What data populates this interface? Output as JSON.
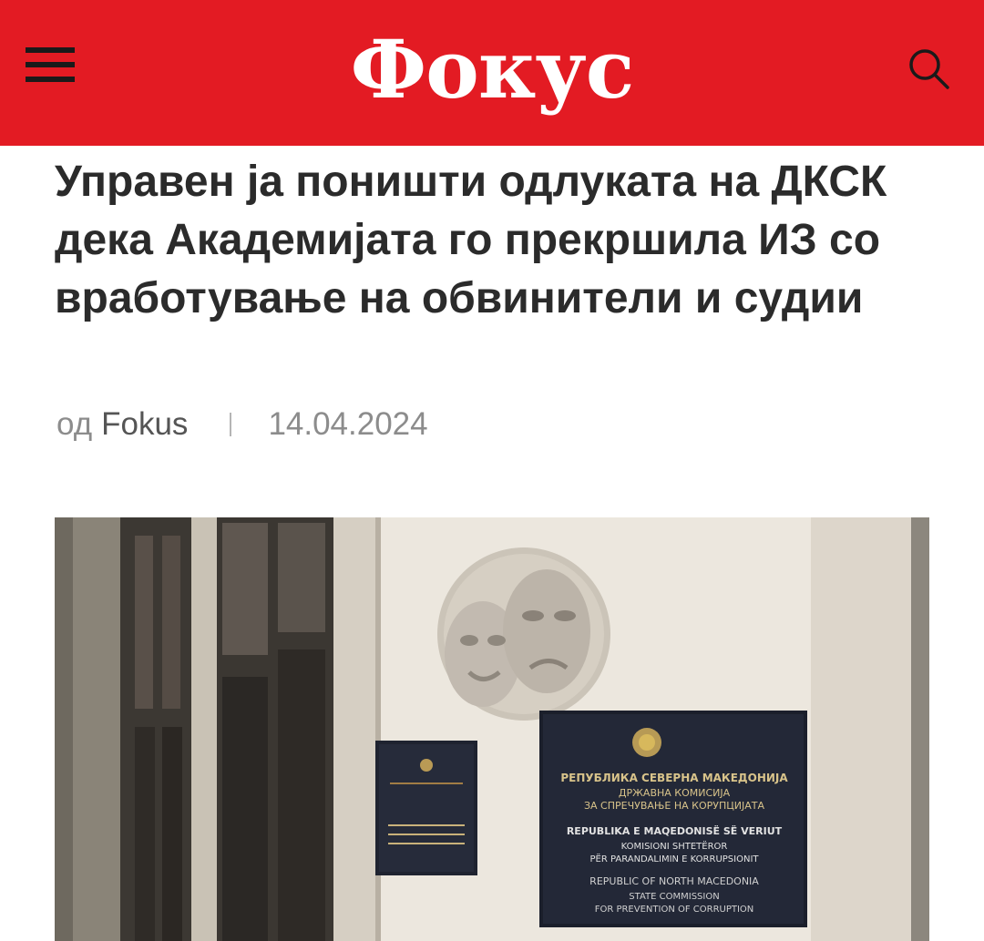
{
  "header": {
    "menu_icon": "hamburger-menu-icon",
    "logo_text": "Фокус",
    "search_icon": "search-icon",
    "brand_color": "#e31b23"
  },
  "article": {
    "title": "Управен ја поништи одлуката на ДКСК дека Академијата го прекршила ИЗ со вработување на обвинители и судии",
    "by_prefix": "од",
    "author": "Fokus",
    "date": "14.04.2024"
  },
  "hero_image": {
    "plaque_main": [
      "РЕПУБЛИКА СЕВЕРНА МАКЕДОНИЈА",
      "ДРЖАВНА КОМИСИЈА",
      "ЗА СПРЕЧУВАЊЕ НА КОРУПЦИЈАТА",
      "REPUBLIKA E MAQEDONISË SË VERIUT",
      "KOMISIONI SHTETËROR",
      "PËR PARANDALIMIN E KORRUPSIONIT",
      "REPUBLIC OF NORTH MACEDONIA",
      "STATE COMMISSION",
      "FOR PREVENTION OF CORRUPTION"
    ]
  }
}
